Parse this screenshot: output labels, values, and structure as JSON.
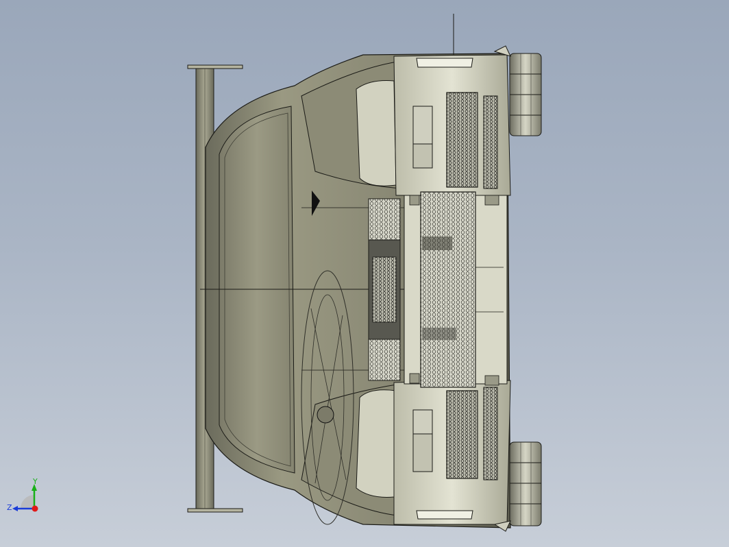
{
  "viewport": {
    "background_top": "#9aa7ba",
    "background_bottom": "#c7ced8"
  },
  "model": {
    "description_icon": "car-model-front-view",
    "body_color": "#8f8e78",
    "body_shadow": "#55554a",
    "body_highlight": "#dcdcc8",
    "mesh_color": "#cfcfc2",
    "edge_color": "#1a1a16"
  },
  "triad": {
    "y_label": "Y",
    "z_label": "Z",
    "y_color": "#18b018",
    "z_color": "#1a3cd8",
    "x_color": "#e01818"
  }
}
